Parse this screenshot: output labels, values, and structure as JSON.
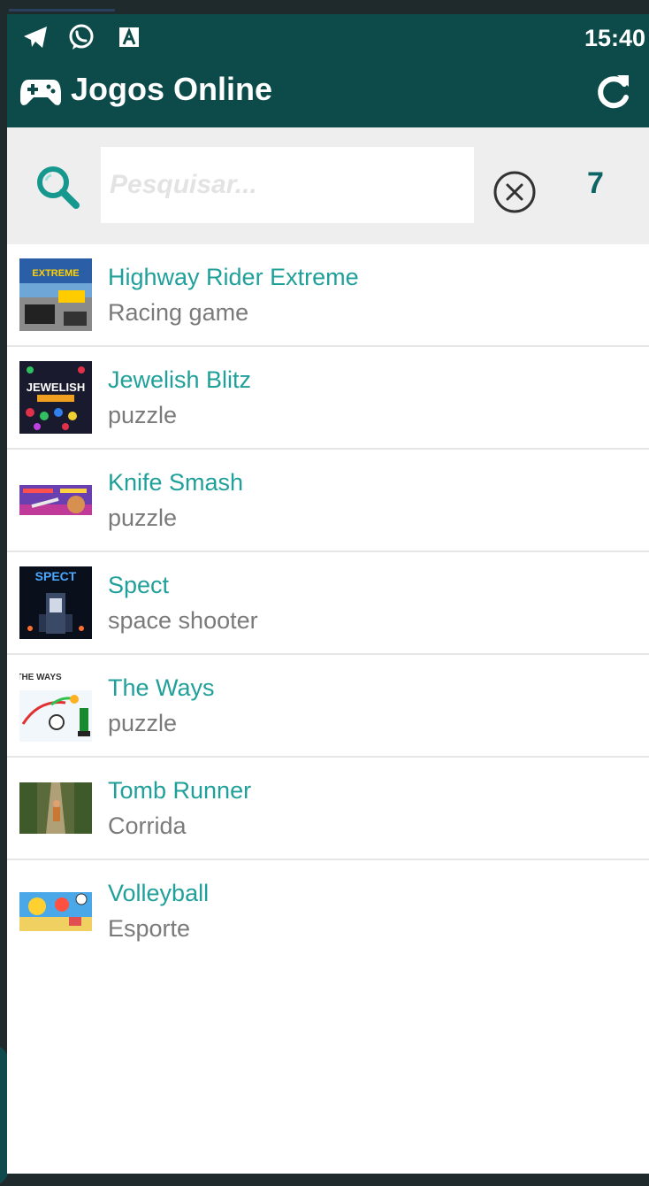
{
  "status_bar": {
    "time": "15:40",
    "icons": [
      "telegram-icon",
      "whatsapp-icon",
      "keyboard-a-icon"
    ]
  },
  "app_bar": {
    "title": "Jogos Online",
    "left_icon": "gamepad-icon",
    "right_icon": "refresh-icon",
    "background": "#0d4b4b"
  },
  "search": {
    "placeholder": "Pesquisar...",
    "value": "",
    "clear_icon": "clear-circle-icon",
    "result_count": "7"
  },
  "games": [
    {
      "name": "Highway Rider Extreme",
      "category": "Racing game",
      "thumb": "highway-rider-thumbnail"
    },
    {
      "name": "Jewelish Blitz",
      "category": "puzzle",
      "thumb": "jewelish-blitz-thumbnail"
    },
    {
      "name": "Knife Smash",
      "category": "puzzle",
      "thumb": "knife-smash-thumbnail"
    },
    {
      "name": "Spect",
      "category": "space shooter",
      "thumb": "spect-thumbnail"
    },
    {
      "name": "The Ways",
      "category": "puzzle",
      "thumb": "the-ways-thumbnail"
    },
    {
      "name": "Tomb Runner",
      "category": "Corrida",
      "thumb": "tomb-runner-thumbnail"
    },
    {
      "name": "Volleyball",
      "category": "Esporte",
      "thumb": "volleyball-thumbnail"
    }
  ],
  "thumb_texts": {
    "highway": "EXTREME",
    "jewelish": "JEWELISH",
    "spect": "SPECT",
    "the_ways": "THE WAYS"
  },
  "colors": {
    "accent": "#20a09a",
    "secondary_text": "#7a7a7a",
    "search_bg": "#eeeeee"
  }
}
